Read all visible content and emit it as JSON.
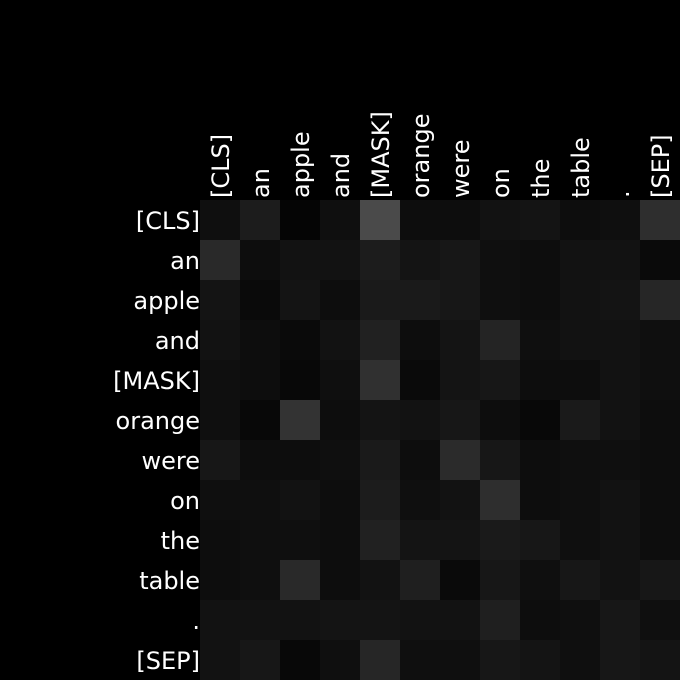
{
  "chart_data": {
    "type": "heatmap",
    "title": "",
    "xlabel": "",
    "ylabel": "",
    "x_labels": [
      "[CLS]",
      "an",
      "apple",
      "and",
      "[MASK]",
      "orange",
      "were",
      "on",
      "the",
      "table",
      ".",
      "[SEP]"
    ],
    "y_labels": [
      "[CLS]",
      "an",
      "apple",
      "and",
      "[MASK]",
      "orange",
      "were",
      "on",
      "the",
      "table",
      ".",
      "[SEP]"
    ],
    "colormap": "grayscale (black = low, white = high)",
    "grid": false,
    "values": [
      [
        0.06,
        0.11,
        0.02,
        0.06,
        0.29,
        0.05,
        0.05,
        0.07,
        0.08,
        0.05,
        0.06,
        0.18
      ],
      [
        0.16,
        0.05,
        0.07,
        0.07,
        0.11,
        0.08,
        0.09,
        0.06,
        0.05,
        0.07,
        0.07,
        0.04
      ],
      [
        0.08,
        0.04,
        0.08,
        0.05,
        0.1,
        0.1,
        0.09,
        0.06,
        0.05,
        0.07,
        0.08,
        0.15
      ],
      [
        0.07,
        0.05,
        0.04,
        0.07,
        0.13,
        0.05,
        0.08,
        0.14,
        0.06,
        0.07,
        0.07,
        0.06
      ],
      [
        0.06,
        0.05,
        0.03,
        0.06,
        0.19,
        0.04,
        0.08,
        0.09,
        0.05,
        0.05,
        0.07,
        0.06
      ],
      [
        0.06,
        0.03,
        0.2,
        0.05,
        0.08,
        0.07,
        0.09,
        0.05,
        0.03,
        0.1,
        0.07,
        0.05
      ],
      [
        0.09,
        0.05,
        0.05,
        0.06,
        0.1,
        0.05,
        0.17,
        0.09,
        0.05,
        0.06,
        0.06,
        0.05
      ],
      [
        0.06,
        0.06,
        0.07,
        0.05,
        0.11,
        0.06,
        0.07,
        0.18,
        0.05,
        0.06,
        0.07,
        0.05
      ],
      [
        0.05,
        0.06,
        0.06,
        0.05,
        0.13,
        0.08,
        0.08,
        0.1,
        0.09,
        0.06,
        0.07,
        0.05
      ],
      [
        0.05,
        0.06,
        0.16,
        0.05,
        0.07,
        0.12,
        0.04,
        0.09,
        0.06,
        0.09,
        0.07,
        0.09
      ],
      [
        0.07,
        0.07,
        0.07,
        0.08,
        0.08,
        0.07,
        0.07,
        0.12,
        0.05,
        0.06,
        0.09,
        0.06
      ],
      [
        0.07,
        0.09,
        0.03,
        0.06,
        0.15,
        0.06,
        0.06,
        0.09,
        0.08,
        0.06,
        0.09,
        0.08
      ]
    ]
  }
}
